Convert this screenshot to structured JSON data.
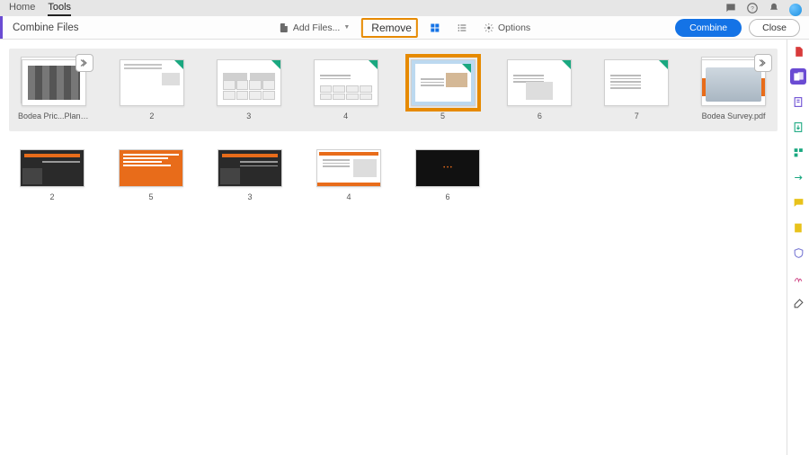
{
  "tabs": {
    "home": "Home",
    "tools": "Tools"
  },
  "toolbar": {
    "title": "Combine Files",
    "add_files": "Add Files...",
    "remove": "Remove",
    "options": "Options",
    "combine": "Combine",
    "close": "Close"
  },
  "group1": {
    "file_a": "Bodea Pric...Plans.pptx",
    "pages": [
      "2",
      "3",
      "4",
      "5",
      "6",
      "7"
    ],
    "file_b": "Bodea Survey.pdf",
    "selected_index": 3
  },
  "group2": {
    "pages": [
      "2",
      "5",
      "3",
      "4",
      "6"
    ]
  },
  "side_icons": [
    "pdf",
    "combine",
    "export",
    "import",
    "scan",
    "comment",
    "fill",
    "protect",
    "sign",
    "more"
  ]
}
